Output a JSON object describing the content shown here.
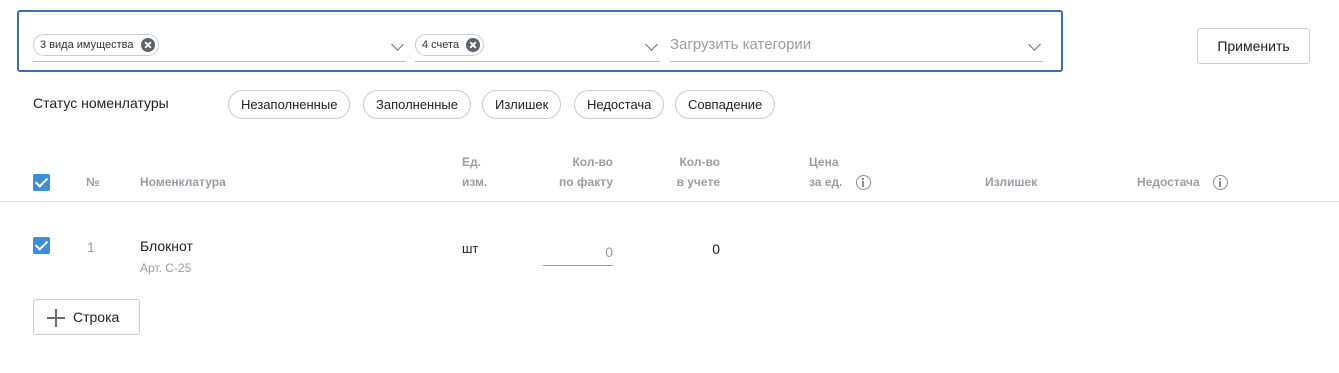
{
  "filters": {
    "property_types": {
      "chip": "3 вида имущества"
    },
    "accounts": {
      "chip": "4 счета"
    },
    "categories": {
      "placeholder": "Загрузить категории"
    },
    "apply_label": "Применить"
  },
  "status": {
    "label": "Статус номенлатуры",
    "chips": [
      "Незаполненные",
      "Заполненные",
      "Излишек",
      "Недостача",
      "Совпадение"
    ]
  },
  "table": {
    "header": {
      "select_all": true,
      "num": "№",
      "nomenclature": "Номенклатура",
      "unit": [
        "Ед.",
        "изм."
      ],
      "qty_fact": [
        "Кол-во",
        "по факту"
      ],
      "qty_account": [
        "Кол-во",
        "в учете"
      ],
      "price": [
        "Цена",
        "за ед."
      ],
      "surplus": "Излишек",
      "shortage": "Недостача"
    },
    "rows": [
      {
        "checked": true,
        "num": "1",
        "name": "Блокнот",
        "article": "Арт. С-25",
        "unit": "шт",
        "qty_fact": "0",
        "qty_account": "0"
      }
    ]
  },
  "add_row_label": "Строка",
  "colors": {
    "accent": "#3d8ed8",
    "panel_border": "#3a6fb0",
    "muted": "#9a9ea4"
  }
}
